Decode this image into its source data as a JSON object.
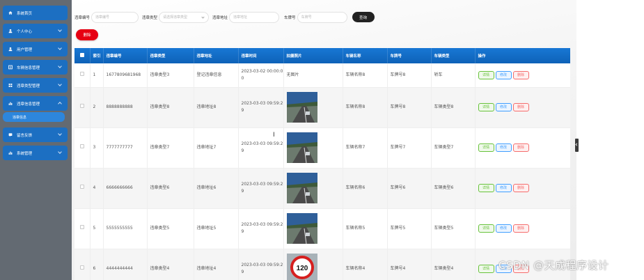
{
  "sidebar": {
    "items": [
      {
        "label": "系统首页",
        "icon": "home-icon",
        "expanded": false,
        "has_chevron": false
      },
      {
        "label": "个人中心",
        "icon": "user-icon",
        "expanded": false,
        "has_chevron": true
      },
      {
        "label": "用户管理",
        "icon": "user-icon",
        "expanded": false,
        "has_chevron": true
      },
      {
        "label": "车辆信息管理",
        "icon": "list-icon",
        "expanded": false,
        "has_chevron": true
      },
      {
        "label": "违章类型管理",
        "icon": "grid-icon",
        "expanded": false,
        "has_chevron": true
      },
      {
        "label": "违章信息管理",
        "icon": "chart-icon",
        "expanded": true,
        "has_chevron": true
      }
    ],
    "sub_item": "违章信息",
    "items_after": [
      {
        "label": "留言反馈",
        "icon": "message-icon",
        "has_chevron": true
      },
      {
        "label": "系统管理",
        "icon": "chart-icon",
        "has_chevron": true
      }
    ]
  },
  "search": {
    "code_label": "违章编号",
    "code_placeholder": "违章编号",
    "type_label": "违章类型",
    "type_placeholder": "请选择违章类型",
    "place_label": "违章地址",
    "place_placeholder": "违章地址",
    "plate_label": "车牌号",
    "plate_placeholder": "车牌号",
    "button": "查询"
  },
  "delete_button": "删除",
  "table": {
    "headers": [
      "索引",
      "违章编号",
      "违章类型",
      "违章地址",
      "违章时间",
      "拍摄照片",
      "车辆名称",
      "车牌号",
      "车辆类型",
      "操作"
    ],
    "rows": [
      {
        "index": "1",
        "code": "1677809681968",
        "type": "违章类型3",
        "place": "登记违章信息",
        "time": "2023-03-02 00:00:00",
        "photo": "无图片",
        "vehicle": "车辆名称8",
        "plate": "车牌号8",
        "vtype": "轿车"
      },
      {
        "index": "2",
        "code": "8888888888",
        "type": "违章类型8",
        "place": "违章地址8",
        "time": "2023-03-03 09:59:29",
        "photo": "road-photo",
        "vehicle": "车辆名称8",
        "plate": "车牌号8",
        "vtype": "车辆类型8"
      },
      {
        "index": "3",
        "code": "7777777777",
        "type": "违章类型7",
        "place": "违章地址7",
        "time": "2023-03-03 09:59:29",
        "photo": "road-photo",
        "vehicle": "车辆名称7",
        "plate": "车牌号7",
        "vtype": "车辆类型7"
      },
      {
        "index": "4",
        "code": "6666666666",
        "type": "违章类型6",
        "place": "违章地址6",
        "time": "2023-03-03 09:59:29",
        "photo": "road-photo",
        "vehicle": "车辆名称6",
        "plate": "车牌号6",
        "vtype": "车辆类型6"
      },
      {
        "index": "5",
        "code": "5555555555",
        "type": "违章类型5",
        "place": "违章地址5",
        "time": "2023-03-03 09:59:29",
        "photo": "road-photo",
        "vehicle": "车辆名称5",
        "plate": "车牌号5",
        "vtype": "车辆类型5"
      },
      {
        "index": "6",
        "code": "4444444444",
        "type": "违章类型4",
        "place": "违章地址4",
        "time": "2023-03-03 09:59:29",
        "photo": "speed-sign-photo",
        "vehicle": "车辆名称4",
        "plate": "车牌号4",
        "vtype": "车辆类型4"
      }
    ],
    "actions": {
      "detail": "详情",
      "edit": "修改",
      "delete": "删除"
    }
  },
  "speed_sign_value": "120",
  "watermark": "CSDN @天成程序设计",
  "cursor_glyph": "I",
  "colors": {
    "nav_blue": "#1c6fc2",
    "delete_red": "#e60012",
    "header_blue": "#1877d4"
  }
}
